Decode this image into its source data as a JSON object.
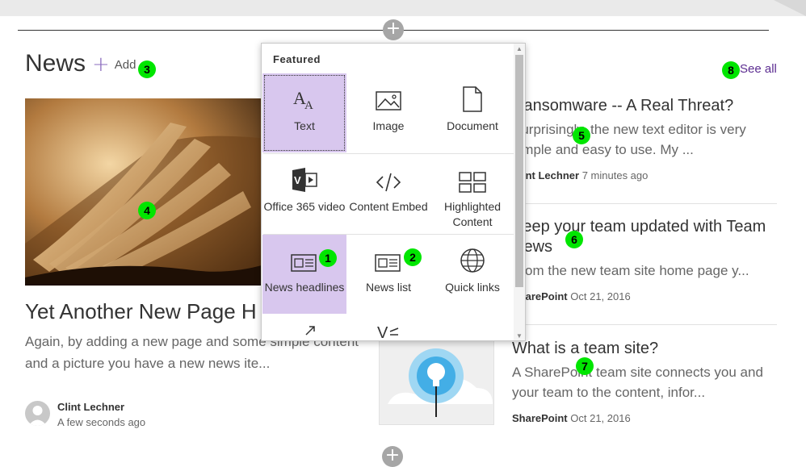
{
  "section": {
    "title": "News",
    "add_label": "Add",
    "see_all_label": "See all"
  },
  "badges": [
    "1",
    "2",
    "3",
    "4",
    "5",
    "6",
    "7",
    "8"
  ],
  "hero": {
    "headline": "Yet Another New Page H",
    "description": "Again, by adding a new page and some simple content and a picture you have a new news ite...",
    "author": "Clint Lechner",
    "time": "A few seconds ago"
  },
  "articles": [
    {
      "title": "Ransomware -- A Real Threat?",
      "description": "Surprisingly, the new text editor is very simple and easy to use.  My ...",
      "author": "Clint Lechner",
      "time": "7 minutes ago"
    },
    {
      "title": "Keep your team updated with Team News",
      "description": "From the new team site home page y...",
      "author": "SharePoint",
      "time": "Oct 21, 2016"
    },
    {
      "title": "What is a team site?",
      "description": "A SharePoint team site connects you and your team to the content, infor...",
      "author": "SharePoint",
      "time": "Oct 21, 2016"
    }
  ],
  "picker": {
    "header": "Featured",
    "tiles": [
      {
        "label": "Text",
        "icon": "text-icon"
      },
      {
        "label": "Image",
        "icon": "image-icon"
      },
      {
        "label": "Document",
        "icon": "document-icon"
      },
      {
        "label": "Office 365 video",
        "icon": "office-video-icon"
      },
      {
        "label": "Content Embed",
        "icon": "embed-icon"
      },
      {
        "label": "Highlighted Content",
        "icon": "highlighted-content-icon"
      },
      {
        "label": "News headlines",
        "icon": "news-headlines-icon"
      },
      {
        "label": "News list",
        "icon": "news-list-icon"
      },
      {
        "label": "Quick links",
        "icon": "globe-icon"
      }
    ]
  },
  "colors": {
    "accent": "#5c2d91",
    "tile_selected": "#d8c7ee",
    "badge": "#00e600"
  }
}
